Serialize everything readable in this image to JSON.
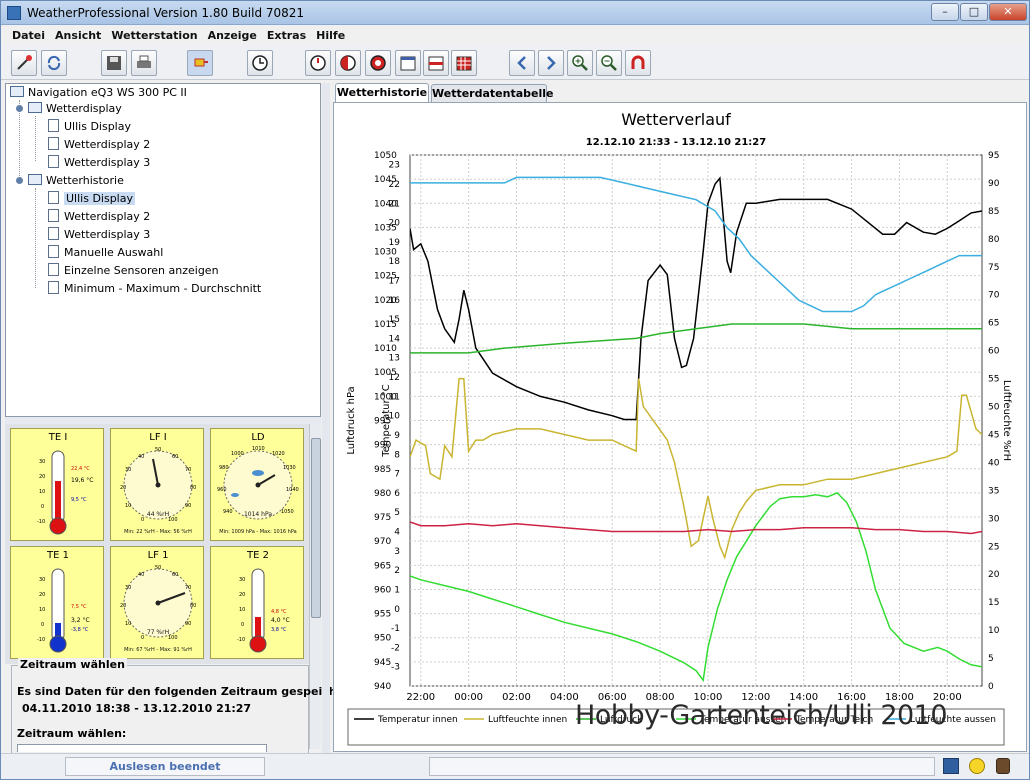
{
  "window": {
    "title": "WeatherProfessional   Version 1.80  Build 70821",
    "min": "–",
    "max": "□",
    "close": "✕"
  },
  "menu": [
    "Datei",
    "Ansicht",
    "Wetterstation",
    "Anzeige",
    "Extras",
    "Hilfe"
  ],
  "toolbar_icons": [
    "wizard-icon",
    "refresh-icon",
    "save-icon",
    "print-icon",
    "pin-icon",
    "clock-icon",
    "clock-icon",
    "clock-icon",
    "clock-icon",
    "calendar-icon",
    "calendar-icon",
    "calendar-icon",
    "back-icon",
    "forward-icon",
    "zoom-in-icon",
    "zoom-out-icon",
    "magnet-icon"
  ],
  "tree": {
    "root": "Navigation eQ3 WS 300 PC II",
    "groups": [
      {
        "label": "Wetterdisplay",
        "items": [
          "Ullis Display",
          "Wetterdisplay 2",
          "Wetterdisplay 3"
        ]
      },
      {
        "label": "Wetterhistorie",
        "items": [
          "Ullis Display",
          "Wetterdisplay 2",
          "Wetterdisplay 3",
          "Manuelle Auswahl",
          "Einzelne Sensoren anzeigen",
          "Minimum - Maximum - Durchschnitt"
        ]
      }
    ],
    "selected": "Ullis Display"
  },
  "gauges": [
    {
      "title": "TE I",
      "value": "19,6 °C",
      "max": "22,4 °C",
      "min": "9,5 °C",
      "scale": [
        "30",
        "20",
        "10",
        "0",
        "-10"
      ]
    },
    {
      "title": "LF I",
      "value": "44 %rH",
      "minmax": "Min: 22 %rH - Max: 56 %rH",
      "scale": [
        "0",
        "10",
        "20",
        "30",
        "40",
        "50",
        "60",
        "70",
        "80",
        "90",
        "100"
      ]
    },
    {
      "title": "LD",
      "value": "1014 hPa",
      "minmax": "Min: 1009 hPa - Max: 1016 hPa",
      "scale": [
        "940",
        "960",
        "980",
        "1000",
        "1010",
        "1020",
        "1030",
        "1040",
        "1050"
      ]
    },
    {
      "title": "TE 1",
      "value": "3,2 °C",
      "max": "7,5 °C",
      "min": "-3,8 °C",
      "scale": [
        "30",
        "20",
        "10",
        "0",
        "-10"
      ]
    },
    {
      "title": "LF 1",
      "value": "77 %rH",
      "minmax": "Min: 67 %rH - Max: 91 %rH",
      "scale": [
        "0",
        "10",
        "20",
        "30",
        "40",
        "50",
        "60",
        "70",
        "80",
        "90",
        "100"
      ]
    },
    {
      "title": "TE 2",
      "value": "4,0 °C",
      "max": "4,8 °C",
      "min": "3,8 °C",
      "scale": [
        "30",
        "20",
        "10",
        "0",
        "-10"
      ]
    }
  ],
  "zeitraum": {
    "legend": "Zeitraum wählen",
    "info": "Es sind Daten für den folgenden Zeitraum gespeichert:",
    "range": "04.11.2010 18:38 - 13.12.2010 21:27",
    "label": "Zeitraum wählen:"
  },
  "tabs": [
    "Wetterhistorie",
    "Wetterdatentabelle"
  ],
  "status": {
    "text": "Auslesen beendet"
  },
  "watermark": "Hobby-Gartenteich/Ulli 2010",
  "chart_data": {
    "type": "line",
    "title": "Wetterverlauf",
    "subtitle": "12.12.10 21:33 - 13.12.10 21:27",
    "ylabel_pressure": "Luftdruck  hPa",
    "ylabel_temp": "Temperatur °C",
    "ylabel_humidity": "Luftfeuchte  %rH",
    "x_ticks": [
      "22:00",
      "00:00",
      "02:00",
      "04:00",
      "06:00",
      "08:00",
      "10:00",
      "12:00",
      "14:00",
      "16:00",
      "18:00",
      "20:00"
    ],
    "x_range_hours": [
      21.55,
      45.45
    ],
    "pressure_range": [
      940,
      1050
    ],
    "temp_range": [
      -4,
      23.5
    ],
    "humidity_range": [
      0,
      95
    ],
    "pressure_ticks": [
      940,
      945,
      950,
      955,
      960,
      965,
      970,
      975,
      980,
      985,
      990,
      995,
      1000,
      1005,
      1010,
      1015,
      1020,
      1025,
      1030,
      1035,
      1040,
      1045,
      1050
    ],
    "temp_ticks": [
      -3,
      -2,
      -1,
      0,
      1,
      2,
      3,
      4,
      5,
      6,
      7,
      8,
      9,
      10,
      11,
      12,
      13,
      14,
      15,
      16,
      17,
      18,
      19,
      20,
      21,
      22,
      23
    ],
    "humidity_ticks": [
      0,
      5,
      10,
      15,
      20,
      25,
      30,
      35,
      40,
      45,
      50,
      55,
      60,
      65,
      70,
      75,
      80,
      85,
      90,
      95
    ],
    "grid": true,
    "legend_position": "bottom",
    "series": [
      {
        "name": "Temperatur innen",
        "axis": "temp",
        "color": "#000000",
        "points": [
          [
            21.55,
            19.7
          ],
          [
            21.7,
            18.6
          ],
          [
            22.0,
            18.9
          ],
          [
            22.3,
            18.0
          ],
          [
            22.7,
            15.5
          ],
          [
            23.0,
            14.5
          ],
          [
            23.4,
            13.8
          ],
          [
            23.6,
            15.0
          ],
          [
            23.8,
            16.5
          ],
          [
            24.0,
            15.5
          ],
          [
            24.3,
            13.5
          ],
          [
            25.0,
            12.2
          ],
          [
            26.0,
            11.5
          ],
          [
            27.0,
            11.0
          ],
          [
            28.0,
            10.7
          ],
          [
            29.0,
            10.3
          ],
          [
            30.0,
            10.0
          ],
          [
            30.5,
            9.8
          ],
          [
            31.0,
            9.8
          ],
          [
            31.2,
            14.0
          ],
          [
            31.5,
            17.0
          ],
          [
            32.0,
            17.8
          ],
          [
            32.3,
            17.3
          ],
          [
            32.6,
            14.0
          ],
          [
            32.9,
            12.5
          ],
          [
            33.1,
            12.6
          ],
          [
            33.4,
            14.0
          ],
          [
            33.8,
            18.5
          ],
          [
            34.0,
            21.0
          ],
          [
            34.3,
            22.0
          ],
          [
            34.5,
            22.3
          ],
          [
            34.8,
            18.0
          ],
          [
            34.95,
            17.4
          ],
          [
            35.2,
            19.5
          ],
          [
            35.6,
            21.0
          ],
          [
            36.0,
            21.0
          ],
          [
            37.0,
            21.2
          ],
          [
            38.0,
            21.2
          ],
          [
            39.0,
            21.2
          ],
          [
            40.0,
            20.7
          ],
          [
            40.7,
            20.0
          ],
          [
            41.3,
            19.4
          ],
          [
            41.8,
            19.4
          ],
          [
            42.3,
            20.0
          ],
          [
            43.0,
            19.5
          ],
          [
            43.5,
            19.4
          ],
          [
            44.0,
            19.7
          ],
          [
            44.5,
            20.1
          ],
          [
            45.0,
            20.5
          ],
          [
            45.45,
            20.6
          ]
        ]
      },
      {
        "name": "Luftfeuchte innen",
        "axis": "humidity",
        "color": "#c9b530",
        "points": [
          [
            21.55,
            41
          ],
          [
            21.8,
            44
          ],
          [
            22.2,
            43
          ],
          [
            22.4,
            38
          ],
          [
            22.8,
            37
          ],
          [
            23.0,
            43
          ],
          [
            23.3,
            41
          ],
          [
            23.6,
            55
          ],
          [
            23.8,
            55
          ],
          [
            24.0,
            42
          ],
          [
            24.3,
            44
          ],
          [
            24.6,
            44
          ],
          [
            25.0,
            45
          ],
          [
            26.0,
            46
          ],
          [
            27.0,
            46
          ],
          [
            28.0,
            45
          ],
          [
            29.0,
            44
          ],
          [
            30.0,
            44
          ],
          [
            30.5,
            43
          ],
          [
            31.0,
            42
          ],
          [
            31.1,
            55
          ],
          [
            31.3,
            50
          ],
          [
            31.8,
            47
          ],
          [
            32.3,
            44
          ],
          [
            32.6,
            40
          ],
          [
            33.0,
            32
          ],
          [
            33.3,
            25
          ],
          [
            33.6,
            26
          ],
          [
            33.8,
            30
          ],
          [
            34.0,
            34
          ],
          [
            34.2,
            30
          ],
          [
            34.5,
            25
          ],
          [
            34.7,
            23
          ],
          [
            35.0,
            28
          ],
          [
            35.3,
            31
          ],
          [
            35.6,
            33
          ],
          [
            36.0,
            35
          ],
          [
            37.0,
            36
          ],
          [
            38.0,
            36
          ],
          [
            39.0,
            37
          ],
          [
            40.0,
            37
          ],
          [
            41.0,
            38
          ],
          [
            42.0,
            39
          ],
          [
            43.0,
            40
          ],
          [
            44.0,
            41
          ],
          [
            44.4,
            42
          ],
          [
            44.6,
            52
          ],
          [
            44.8,
            52
          ],
          [
            45.2,
            46
          ],
          [
            45.45,
            45
          ]
        ]
      },
      {
        "name": "Luftdruck",
        "axis": "pressure",
        "color": "#2cb52c",
        "points": [
          [
            21.55,
            1009
          ],
          [
            24.0,
            1009
          ],
          [
            25.5,
            1010
          ],
          [
            28.0,
            1011
          ],
          [
            31.0,
            1012
          ],
          [
            32.0,
            1013
          ],
          [
            33.5,
            1014
          ],
          [
            35.0,
            1015
          ],
          [
            36.0,
            1015
          ],
          [
            38.0,
            1015
          ],
          [
            40.0,
            1014
          ],
          [
            42.0,
            1014
          ],
          [
            45.0,
            1014
          ],
          [
            45.45,
            1014
          ]
        ]
      },
      {
        "name": "Temperatur aussen",
        "axis": "temp",
        "color": "#33dd33",
        "points": [
          [
            21.55,
            1.7
          ],
          [
            22.0,
            1.5
          ],
          [
            23.0,
            1.2
          ],
          [
            24.0,
            0.9
          ],
          [
            25.0,
            0.5
          ],
          [
            26.0,
            0.1
          ],
          [
            27.0,
            -0.3
          ],
          [
            28.0,
            -0.7
          ],
          [
            29.0,
            -1.0
          ],
          [
            30.0,
            -1.3
          ],
          [
            31.0,
            -1.7
          ],
          [
            32.0,
            -2.2
          ],
          [
            33.0,
            -2.8
          ],
          [
            33.5,
            -3.2
          ],
          [
            33.8,
            -3.7
          ],
          [
            34.0,
            -2.0
          ],
          [
            34.4,
            0.0
          ],
          [
            34.8,
            1.5
          ],
          [
            35.2,
            2.7
          ],
          [
            35.6,
            3.5
          ],
          [
            36.0,
            4.3
          ],
          [
            36.6,
            5.3
          ],
          [
            37.0,
            5.7
          ],
          [
            37.5,
            5.8
          ],
          [
            38.0,
            5.8
          ],
          [
            38.5,
            5.9
          ],
          [
            39.0,
            5.8
          ],
          [
            39.4,
            6.0
          ],
          [
            39.8,
            5.5
          ],
          [
            40.2,
            4.5
          ],
          [
            40.6,
            3.0
          ],
          [
            41.0,
            1.0
          ],
          [
            41.6,
            -1.0
          ],
          [
            42.2,
            -1.8
          ],
          [
            43.0,
            -2.2
          ],
          [
            43.6,
            -2.0
          ],
          [
            44.0,
            -2.2
          ],
          [
            44.5,
            -2.6
          ],
          [
            45.0,
            -2.9
          ],
          [
            45.45,
            -3.0
          ]
        ]
      },
      {
        "name": "Temperatur Teich",
        "axis": "temp",
        "color": "#cc2244",
        "points": [
          [
            21.55,
            4.5
          ],
          [
            22.0,
            4.3
          ],
          [
            23.0,
            4.3
          ],
          [
            24.0,
            4.4
          ],
          [
            25.0,
            4.3
          ],
          [
            26.0,
            4.4
          ],
          [
            27.0,
            4.3
          ],
          [
            28.0,
            4.2
          ],
          [
            29.0,
            4.1
          ],
          [
            30.0,
            4.0
          ],
          [
            31.0,
            4.0
          ],
          [
            32.0,
            4.0
          ],
          [
            33.0,
            4.0
          ],
          [
            34.0,
            4.1
          ],
          [
            35.0,
            4.0
          ],
          [
            36.0,
            4.1
          ],
          [
            37.0,
            4.1
          ],
          [
            38.0,
            4.2
          ],
          [
            39.0,
            4.2
          ],
          [
            40.0,
            4.2
          ],
          [
            41.0,
            4.1
          ],
          [
            42.0,
            4.1
          ],
          [
            43.0,
            4.0
          ],
          [
            44.0,
            4.0
          ],
          [
            45.0,
            3.9
          ],
          [
            45.45,
            4.0
          ]
        ]
      },
      {
        "name": "Luftfeuchte aussen",
        "axis": "humidity",
        "color": "#3aaee0",
        "points": [
          [
            21.55,
            90
          ],
          [
            22.0,
            90
          ],
          [
            24.0,
            90
          ],
          [
            25.5,
            90
          ],
          [
            26.0,
            91
          ],
          [
            28.0,
            91
          ],
          [
            29.5,
            91
          ],
          [
            30.5,
            90
          ],
          [
            31.5,
            89
          ],
          [
            32.5,
            88
          ],
          [
            33.5,
            87
          ],
          [
            34.3,
            85
          ],
          [
            34.8,
            82
          ],
          [
            35.3,
            80
          ],
          [
            35.8,
            77
          ],
          [
            36.3,
            75
          ],
          [
            36.8,
            73
          ],
          [
            37.3,
            71
          ],
          [
            37.8,
            69
          ],
          [
            38.3,
            68
          ],
          [
            38.8,
            67
          ],
          [
            39.5,
            67
          ],
          [
            40.0,
            67
          ],
          [
            40.5,
            68
          ],
          [
            41.0,
            70
          ],
          [
            41.5,
            71
          ],
          [
            42.0,
            72
          ],
          [
            42.5,
            73
          ],
          [
            43.0,
            74
          ],
          [
            43.5,
            75
          ],
          [
            44.0,
            76
          ],
          [
            44.5,
            77
          ],
          [
            45.0,
            77
          ],
          [
            45.45,
            77
          ]
        ]
      }
    ]
  }
}
